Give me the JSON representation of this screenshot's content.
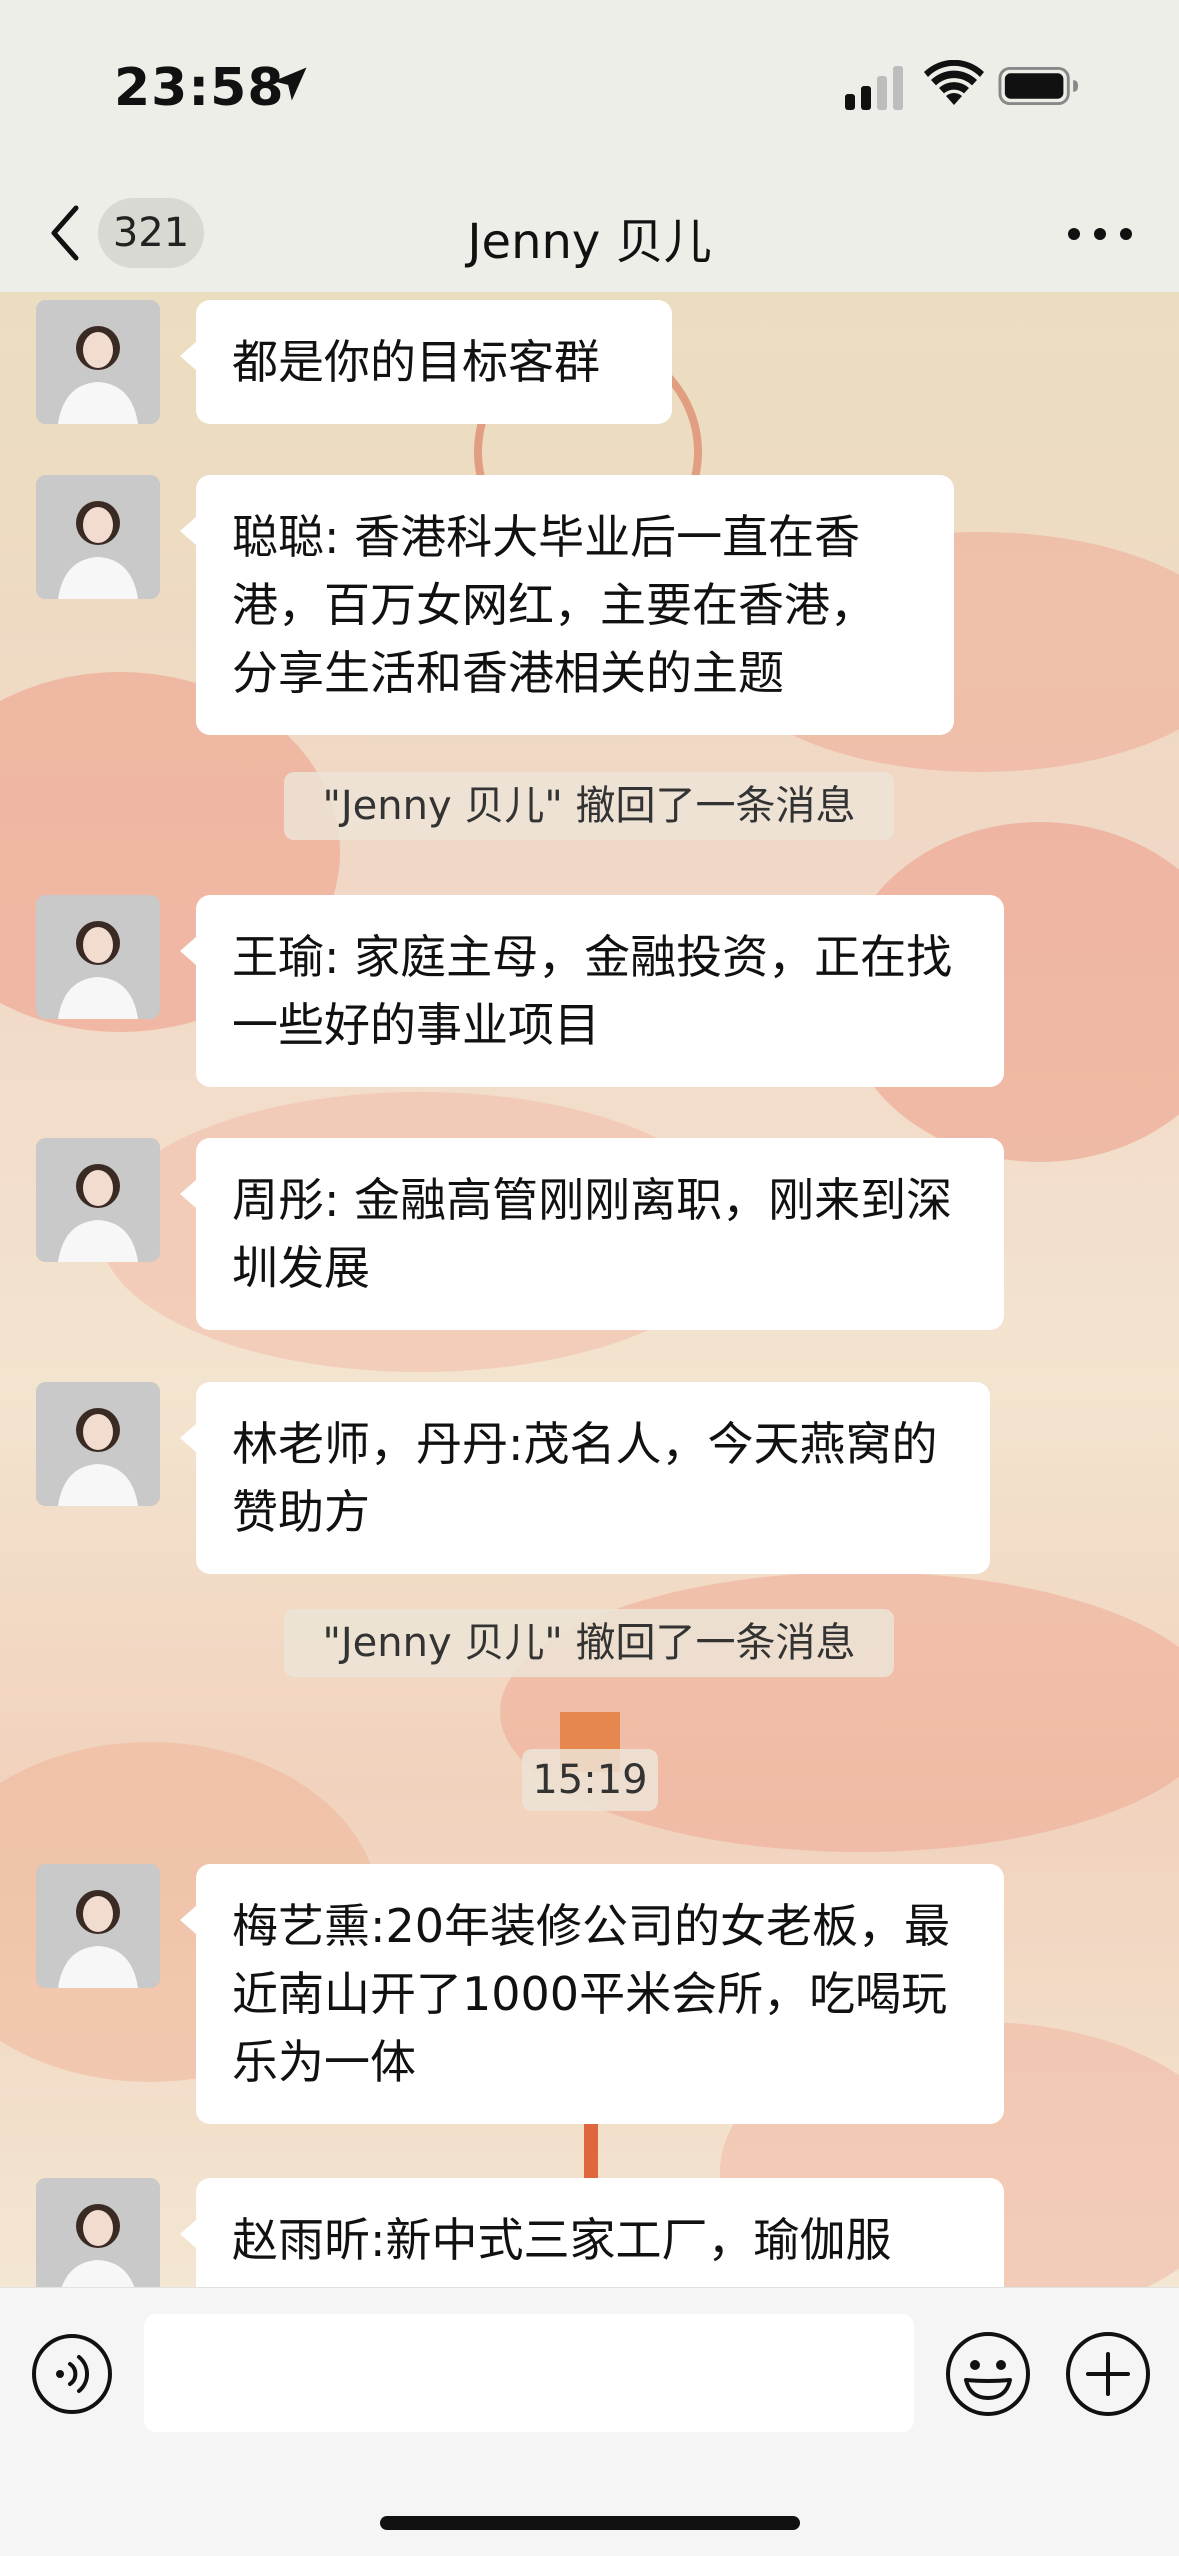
{
  "status_bar": {
    "time": "23:58",
    "icons": [
      "location-arrow-icon",
      "cellular-signal-icon",
      "wifi-icon",
      "battery-icon"
    ]
  },
  "nav": {
    "back_icon": "chevron-left-icon",
    "unread_count": "321",
    "title": "Jenny 贝儿",
    "more_icon": "ellipsis-icon"
  },
  "messages": [
    {
      "text": "都是你的目标客群"
    },
    {
      "text": "聪聪: 香港科大毕业后一直在香港，百万女网红，主要在香港，分享生活和香港相关的主题"
    },
    {
      "system": "\"Jenny 贝儿\" 撤回了一条消息"
    },
    {
      "text": "王瑜: 家庭主母，金融投资，正在找一些好的事业项目"
    },
    {
      "text": "周彤: 金融高管刚刚离职，刚来到深圳发展"
    },
    {
      "text": "林老师，丹丹:茂名人，今天燕窝的赞助方"
    },
    {
      "system": "\"Jenny 贝儿\" 撤回了一条消息"
    },
    {
      "timestamp": "15:19"
    },
    {
      "text": "梅艺熏:20年装修公司的女老板，最近南山开了1000平米会所，吃喝玩乐为一体"
    },
    {
      "text": "赵雨昕:新中式三家工厂，瑜伽服"
    }
  ],
  "input_bar": {
    "voice_icon": "voice-input-icon",
    "input_value": "",
    "emoji_icon": "emoji-icon",
    "plus_icon": "plus-icon"
  },
  "colors": {
    "bubble": "#ffffff",
    "bar_background": "#eeeee8",
    "accent_decor": "#e8735a"
  }
}
